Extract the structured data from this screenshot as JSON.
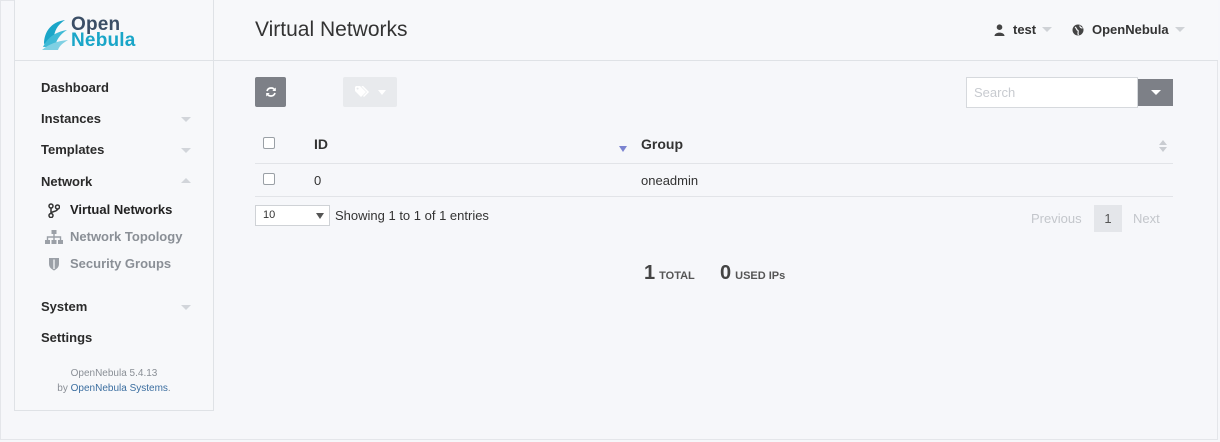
{
  "app": {
    "logo_line1": "Open",
    "logo_line2": "Nebula",
    "version": "OpenNebula 5.4.13",
    "by_prefix": "by",
    "company": "OpenNebula Systems",
    "company_suffix": "."
  },
  "sidebar": {
    "items": [
      {
        "label": "Dashboard"
      },
      {
        "label": "Instances"
      },
      {
        "label": "Templates"
      },
      {
        "label": "Network"
      },
      {
        "label": "System"
      },
      {
        "label": "Settings"
      }
    ],
    "network_sub": [
      {
        "label": "Virtual Networks",
        "icon": "branch-icon",
        "active": true
      },
      {
        "label": "Network Topology",
        "icon": "sitemap-icon",
        "active": false
      },
      {
        "label": "Security Groups",
        "icon": "shield-icon",
        "active": false
      }
    ]
  },
  "header": {
    "title": "Virtual Networks",
    "user": "test",
    "zone": "OpenNebula"
  },
  "toolbar": {
    "search_placeholder": "Search"
  },
  "table": {
    "columns": [
      "ID",
      "Group"
    ],
    "rows": [
      {
        "id": "0",
        "group": "oneadmin"
      }
    ],
    "length": "10",
    "info": "Showing 1 to 1 of 1 entries",
    "prev": "Previous",
    "current_page": "1",
    "next": "Next"
  },
  "stats": {
    "total_value": "1",
    "total_label": "TOTAL",
    "used_value": "0",
    "used_label": "USED IPs"
  },
  "colors": {
    "accent": "#1aa6c8",
    "sort_indicator": "#7b83d0",
    "button_dark": "#7d8087"
  }
}
